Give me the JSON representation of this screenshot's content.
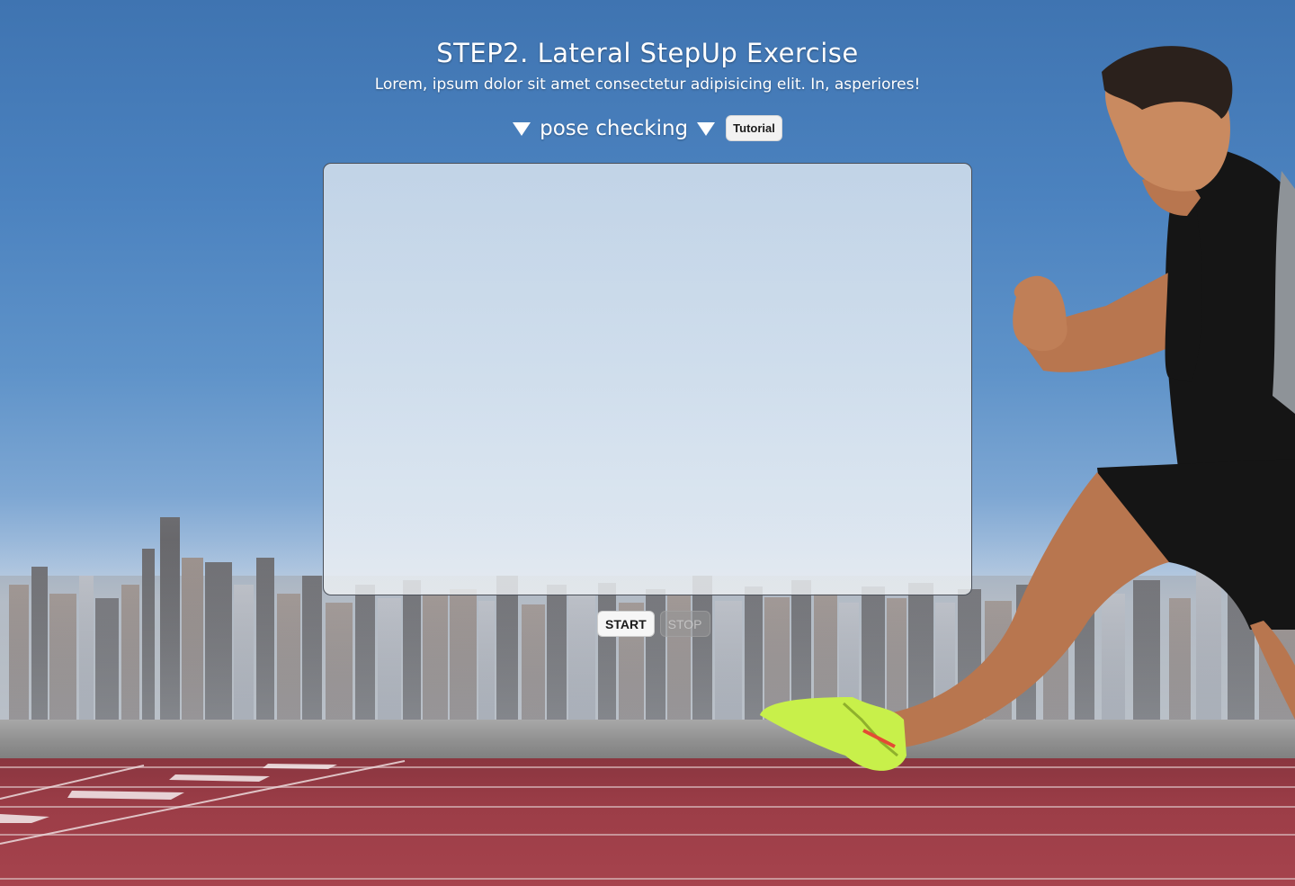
{
  "header": {
    "title": "STEP2. Lateral StepUp Exercise",
    "subtitle": "Lorem, ipsum dolor sit amet consectetur adipisicing elit. In, asperiores!"
  },
  "pose": {
    "label": "pose checking",
    "tutorial_label": "Tutorial"
  },
  "controls": {
    "start_label": "START",
    "stop_label": "STOP"
  },
  "colors": {
    "sky": "#4b82bf",
    "track": "#9c3d47",
    "button_bg": "#f6f6f6",
    "shoe": "#c8f04a"
  },
  "icons": {
    "left_indicator": "triangle-down-icon",
    "right_indicator": "triangle-down-icon"
  }
}
